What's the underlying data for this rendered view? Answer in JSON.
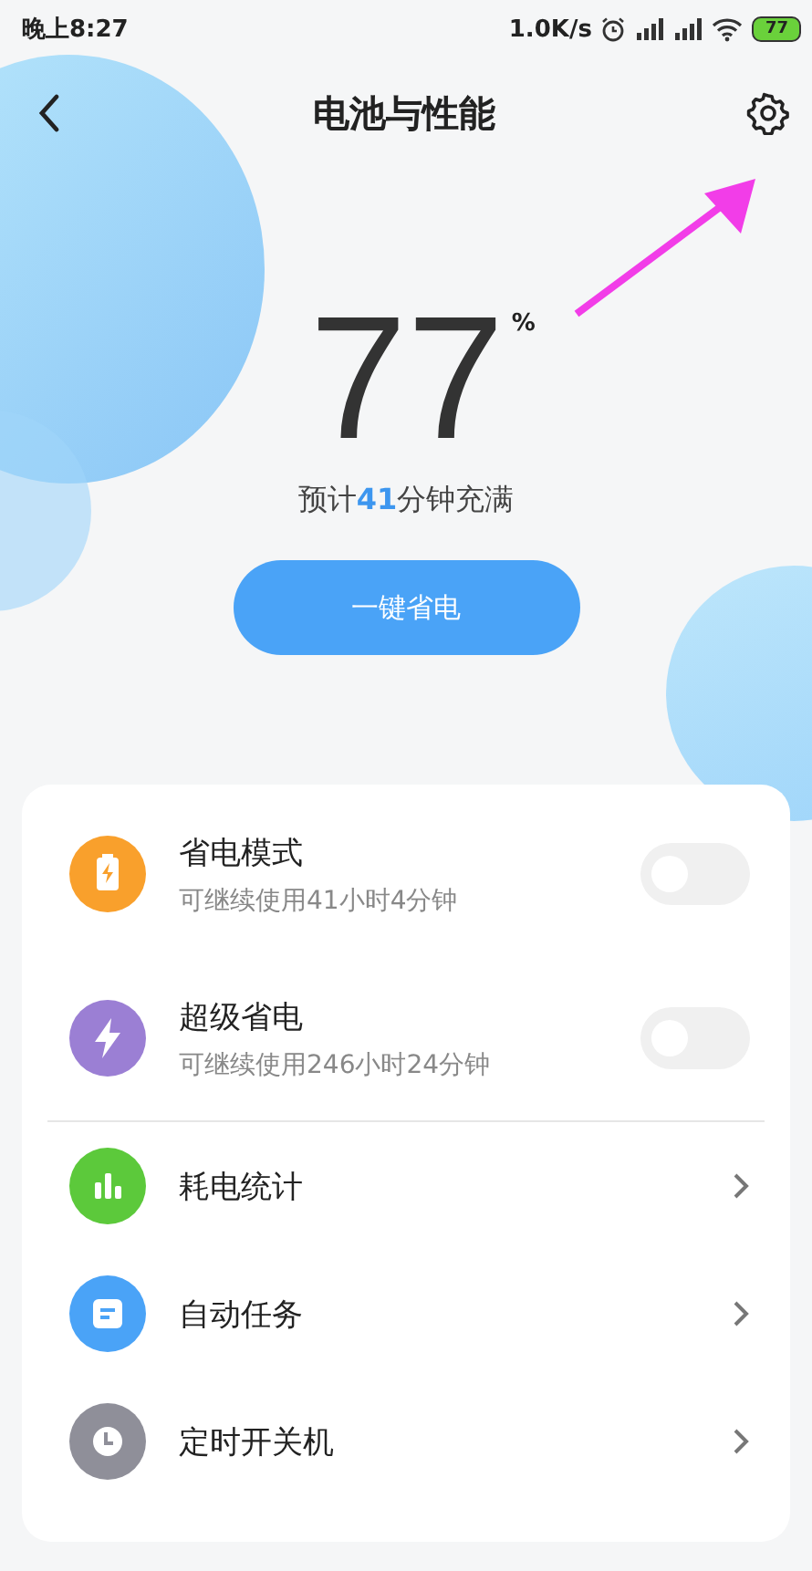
{
  "status_bar": {
    "time": "晚上8:27",
    "speed": "1.0K/s",
    "battery": "77"
  },
  "header": {
    "title": "电池与性能"
  },
  "battery": {
    "percent": "77",
    "unit": "%",
    "eta_prefix": "预计",
    "eta_value": "41",
    "eta_suffix": "分钟充满"
  },
  "save_button": "一键省电",
  "items": [
    {
      "kind": "toggle",
      "title": "省电模式",
      "subtitle": "可继续使用41小时4分钟",
      "on": false,
      "color": "#f9a02c"
    },
    {
      "kind": "toggle",
      "title": "超级省电",
      "subtitle": "可继续使用246小时24分钟",
      "on": false,
      "color": "#9b7fd4"
    },
    {
      "kind": "divider"
    },
    {
      "kind": "link",
      "title": "耗电统计",
      "color": "#5cc93b"
    },
    {
      "kind": "link",
      "title": "自动任务",
      "color": "#4aa3f7"
    },
    {
      "kind": "link",
      "title": "定时开关机",
      "color": "#8f8f99"
    }
  ]
}
